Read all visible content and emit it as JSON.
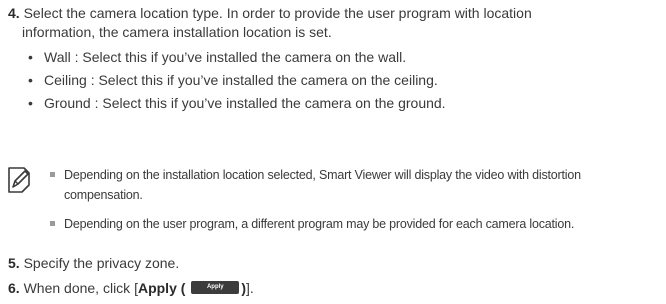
{
  "step4": {
    "num": "4.",
    "line1": "Select the camera location type. In order to provide the user program with location",
    "line2": "information, the camera installation location is set.",
    "bullets": [
      "Wall : Select this if you’ve installed the camera on the wall.",
      "Ceiling : Select this if you’ve installed the camera on the ceiling.",
      "Ground : Select this if you’ve installed the camera on the ground."
    ]
  },
  "notes": {
    "icon": "note-pencil-icon",
    "items": [
      "Depending on the installation location selected, Smart Viewer will display the video with distortion compensation.",
      "Depending on the user program, a different program may be provided for each camera location."
    ]
  },
  "step5": {
    "num": "5.",
    "text": "Specify the privacy zone."
  },
  "step6": {
    "num": "6.",
    "text": "When done, click [",
    "bold_label": "Apply (",
    "button_label": "Apply",
    "bold_close": ")",
    "tail": "]."
  },
  "bullet_glyph": "•"
}
